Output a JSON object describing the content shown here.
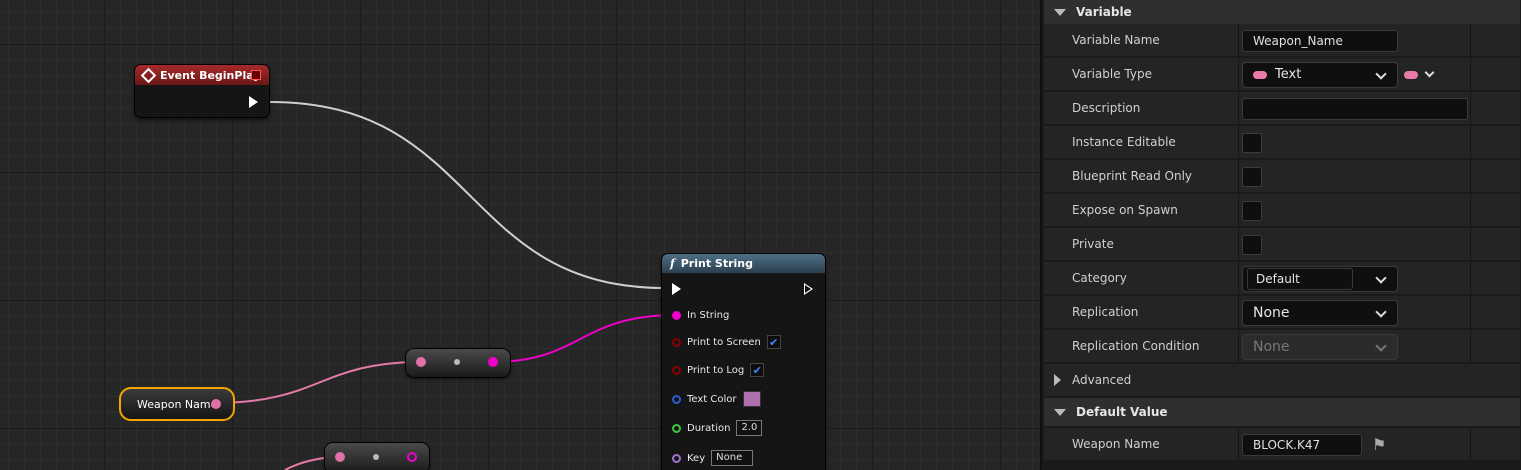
{
  "graph": {
    "event_node": {
      "title": "Event BeginPlay"
    },
    "print_node": {
      "title": "Print String",
      "func_glyph": "f",
      "pins": {
        "in_string": "In String",
        "print_to_screen": "Print to Screen",
        "print_to_log": "Print to Log",
        "text_color": "Text Color",
        "duration": "Duration",
        "duration_value": "2.0",
        "key": "Key",
        "key_value": "None"
      }
    },
    "variable_node": {
      "label": "Weapon Name"
    },
    "colors": {
      "text_pin": "#e070a8",
      "string_pin": "#f000c8",
      "exec_wire": "#cfcfcf"
    }
  },
  "details": {
    "variable_section": {
      "title": "Variable"
    },
    "rows": {
      "variable_name": {
        "label": "Variable Name",
        "value": "Weapon_Name"
      },
      "variable_type": {
        "label": "Variable Type",
        "value": "Text"
      },
      "description": {
        "label": "Description",
        "value": ""
      },
      "instance_editable": {
        "label": "Instance Editable"
      },
      "blueprint_read_only": {
        "label": "Blueprint Read Only"
      },
      "expose_on_spawn": {
        "label": "Expose on Spawn"
      },
      "private": {
        "label": "Private"
      },
      "category": {
        "label": "Category",
        "value": "Default"
      },
      "replication": {
        "label": "Replication",
        "value": "None"
      },
      "replication_condition": {
        "label": "Replication Condition",
        "value": "None"
      }
    },
    "advanced": {
      "label": "Advanced"
    },
    "default_value_section": {
      "title": "Default Value"
    },
    "weapon_name": {
      "label": "Weapon Name",
      "value": "BLOCK.K47"
    }
  }
}
